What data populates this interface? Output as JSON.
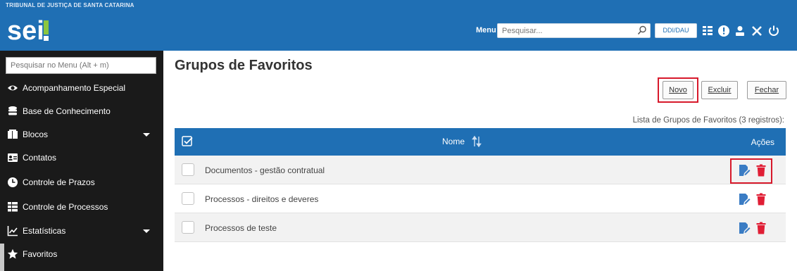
{
  "header": {
    "org_name": "TRIBUNAL DE JUSTIÇA DE SANTA CATARINA",
    "logo_text": "sei!",
    "menu_label": "Menu",
    "search_placeholder": "Pesquisar...",
    "unit_label": "DDI/DAU",
    "icons": [
      "grid-icon",
      "info-icon",
      "user-icon",
      "tools-icon",
      "power-icon"
    ]
  },
  "sidebar": {
    "search_placeholder": "Pesquisar no Menu (Alt + m)",
    "items": [
      {
        "label": "Acompanhamento Especial",
        "icon": "eye-icon",
        "has_submenu": false
      },
      {
        "label": "Base de Conhecimento",
        "icon": "database-icon",
        "has_submenu": false
      },
      {
        "label": "Blocos",
        "icon": "blocks-icon",
        "has_submenu": true
      },
      {
        "label": "Contatos",
        "icon": "contact-card-icon",
        "has_submenu": false
      },
      {
        "label": "Controle de Prazos",
        "icon": "clock-icon",
        "has_submenu": false
      },
      {
        "label": "Controle de Processos",
        "icon": "list-icon",
        "has_submenu": false
      },
      {
        "label": "Estatísticas",
        "icon": "chart-icon",
        "has_submenu": true
      },
      {
        "label": "Favoritos",
        "icon": "star-icon",
        "has_submenu": false
      }
    ]
  },
  "main": {
    "title": "Grupos de Favoritos",
    "buttons": {
      "novo": "Novo",
      "excluir": "Excluir",
      "fechar": "Fechar"
    },
    "list_caption": "Lista de Grupos de Favoritos (3 registros):",
    "table": {
      "columns": {
        "name": "Nome",
        "actions": "Ações"
      },
      "rows": [
        {
          "name": "Documentos - gestão contratual"
        },
        {
          "name": "Processos - direitos e deveres"
        },
        {
          "name": "Processos de teste"
        }
      ]
    }
  },
  "colors": {
    "header_blue": "#1f6fb4",
    "sidebar_bg": "#1a1a1a",
    "highlight_red": "#d7192b",
    "delete_red": "#e01e35",
    "edit_blue": "#3a7cc4"
  }
}
